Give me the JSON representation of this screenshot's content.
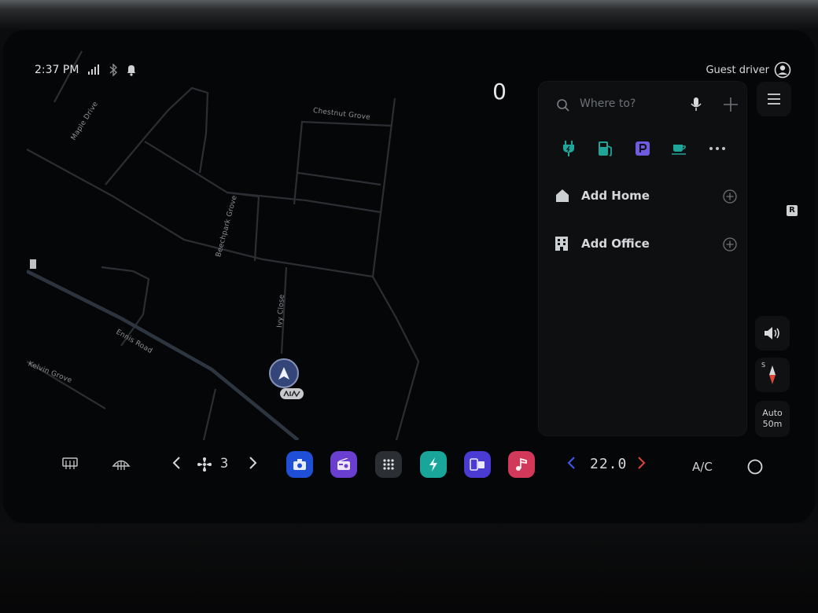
{
  "status_bar": {
    "time": "2:37 PM"
  },
  "profile": {
    "label": "Guest driver"
  },
  "speed": {
    "value": "0"
  },
  "map": {
    "streets": [
      "Maple Drive",
      "Chestnut Grove",
      "Beechpark Grove",
      "Ivy Close",
      "Ennis Road",
      "Kelvin Grove"
    ]
  },
  "search": {
    "placeholder": "Where to?"
  },
  "shortcuts": {
    "home_label": "Add Home",
    "office_label": "Add Office"
  },
  "side": {
    "r_badge": "R",
    "compass_dir": "S",
    "zoom_mode": "Auto",
    "zoom_scale": "50m"
  },
  "climate": {
    "fan_level": "3",
    "temperature": "22.0",
    "ac_label": "A/C"
  },
  "colors": {
    "camera": "#1f4fd6",
    "radio": "#6a3fd0",
    "apps": "#2b2e33",
    "ev": "#1aa59a",
    "phone_projection": "#4a3bd2",
    "music": "#d2385a",
    "temp_down": "#3d5bf0",
    "temp_up": "#e0453a",
    "ev_icon": "#1fa69b",
    "parking": "#6d5be0"
  }
}
